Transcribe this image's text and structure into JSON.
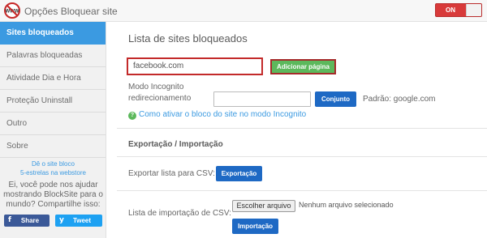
{
  "header": {
    "app_title": "Opções Bloquear site",
    "logo_text": "WWW",
    "toggle_label": "ON"
  },
  "sidebar": {
    "items": [
      {
        "label": "Sites bloqueados",
        "active": true
      },
      {
        "label": "Palavras bloqueadas",
        "active": false
      },
      {
        "label": "Atividade Dia e Hora",
        "active": false
      },
      {
        "label": "Proteção Uninstall",
        "active": false
      },
      {
        "label": "Outro",
        "active": false
      },
      {
        "label": "Sobre",
        "active": false
      }
    ],
    "promo_link_line1": "Dê o site bloco",
    "promo_link_line2": "5-estrelas na webstore",
    "promo_text": "Ei, você pode nos ajudar mostrando BlockSite para o mundo? Compartilhe isso:",
    "share_facebook": "Share",
    "share_twitter": "Tweet"
  },
  "main": {
    "title": "Lista de sites bloqueados",
    "url_input_value": "facebook.com",
    "add_button": "Adicionar página",
    "incognito_label_line1": "Modo Incognito",
    "incognito_label_line2": "redirecionamento",
    "redirect_input_value": "",
    "set_button": "Conjunto",
    "default_text": "Padrão: google.com",
    "help_link": "Como ativar o bloco do site no modo Incognito",
    "export_import_title": "Exportação / Importação",
    "export_label": "Exportar lista para CSV:",
    "export_button": "Exportação",
    "import_label": "Lista de importação de CSV:",
    "choose_file_button": "Escolher arquivo",
    "file_status": "Nenhum arquivo selecionado",
    "import_button": "Importação"
  },
  "colors": {
    "accent_blue": "#3b9ae1",
    "button_blue": "#1e69c4",
    "add_green": "#5cb85c",
    "toggle_red": "#d83a3a",
    "highlight_red": "#c32a2a"
  },
  "icons": {
    "logo": "no-www-icon",
    "help": "question-circle-icon",
    "facebook": "facebook-icon",
    "twitter": "twitter-icon"
  }
}
